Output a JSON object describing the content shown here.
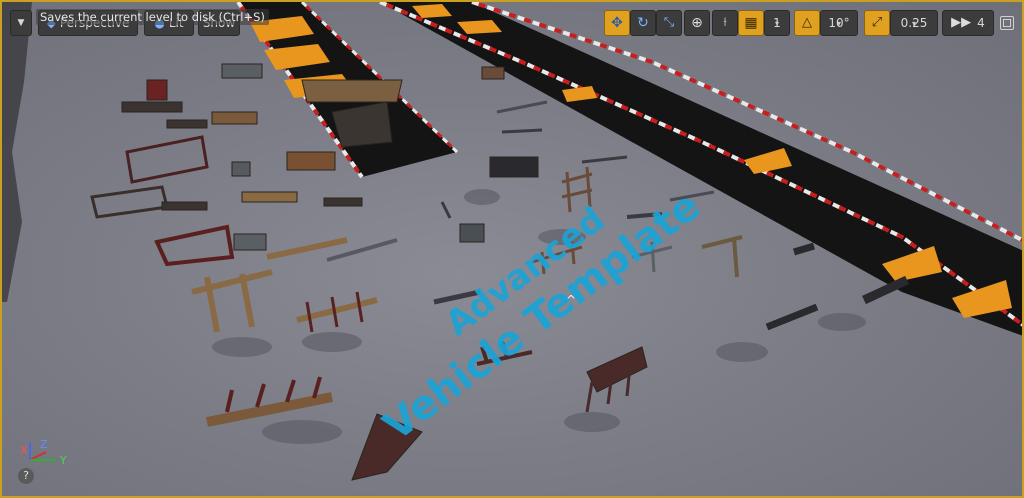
{
  "viewport": {
    "view_mode": "Perspective",
    "lighting_mode": "Lit",
    "show_label": "Show",
    "tooltip": "Saves the current level to disk (Ctrl+S)",
    "grid_snap_value": "1",
    "rotation_snap_value": "10°",
    "scale_snap_value": "0.25",
    "camera_speed_value": "4"
  },
  "scene": {
    "overlay_line1": "Advanced",
    "overlay_line2": "Vehicle Template"
  },
  "gizmo": {
    "x_label": "X",
    "y_label": "Y",
    "z_label": "Z"
  },
  "icons": [
    "menu-chevron-icon",
    "perspective-icon",
    "lit-sphere-icon",
    "translate-icon",
    "rotate-icon",
    "scale-icon",
    "world-local-icon",
    "surface-snap-icon",
    "grid-snap-icon",
    "rotation-snap-icon",
    "scale-snap-icon",
    "camera-speed-icon",
    "maximize-icon",
    "help-icon"
  ],
  "colors": {
    "active_tool": "#e0a020",
    "toolbar_bg": "#3c3c3c",
    "floor": "#7c7d86",
    "track": "#141414",
    "overlay_text": "#1aa3d6",
    "viewport_border": "#c9a020"
  }
}
